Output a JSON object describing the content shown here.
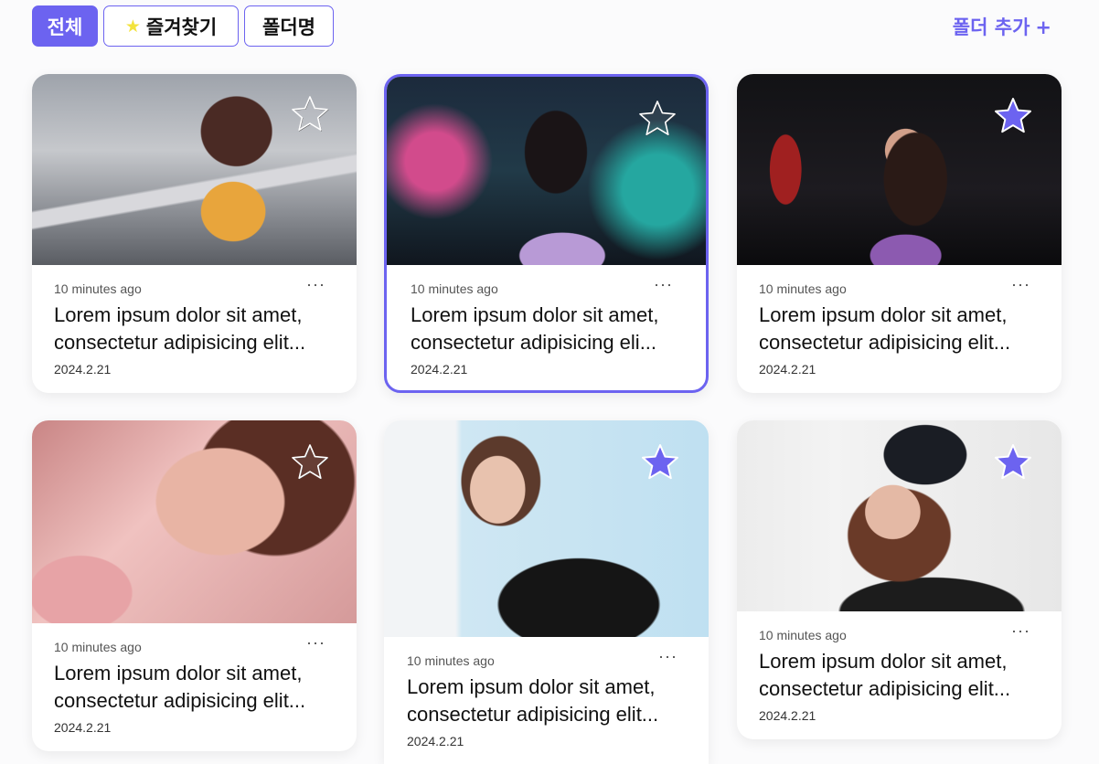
{
  "filters": {
    "all": "전체",
    "favorites": "즐겨찾기",
    "folder": "폴더명"
  },
  "add_folder": {
    "label": "폴더 추가",
    "plus": "+"
  },
  "colors": {
    "accent": "#6c63f0",
    "star_filled": "#6c63f0",
    "star_chip": "#f3e33d"
  },
  "cards": [
    {
      "time": "10 minutes ago",
      "more": "···",
      "title": "Lorem ipsum dolor sit amet, consectetur adipisicing elit...",
      "date": "2024.2.21",
      "favorite": false,
      "selected": false,
      "image": "street-photo"
    },
    {
      "time": "10 minutes ago",
      "more": "···",
      "title": "Lorem ipsum dolor sit amet, consectetur adipisicing eli...",
      "date": "2024.2.21",
      "favorite": false,
      "selected": true,
      "image": "neon-night-photo"
    },
    {
      "time": "10 minutes ago",
      "more": "···",
      "title": "Lorem ipsum dolor sit amet, consectetur adipisicing elit...",
      "date": "2024.2.21",
      "favorite": true,
      "selected": false,
      "image": "dark-portrait-photo"
    },
    {
      "time": "10 minutes ago",
      "more": "···",
      "title": "Lorem ipsum dolor sit amet, consectetur adipisicing elit...",
      "date": "2024.2.21",
      "favorite": false,
      "selected": false,
      "image": "pink-balloon-photo"
    },
    {
      "time": "10 minutes ago",
      "more": "···",
      "title": "Lorem ipsum dolor sit amet, consectetur adipisicing elit...",
      "date": "2024.2.21",
      "favorite": true,
      "selected": false,
      "image": "light-blue-portrait-photo"
    },
    {
      "time": "10 minutes ago",
      "more": "···",
      "title": "Lorem ipsum dolor sit amet, consectetur adipisicing elit...",
      "date": "2024.2.21",
      "favorite": true,
      "selected": false,
      "image": "beanie-portrait-photo"
    }
  ]
}
